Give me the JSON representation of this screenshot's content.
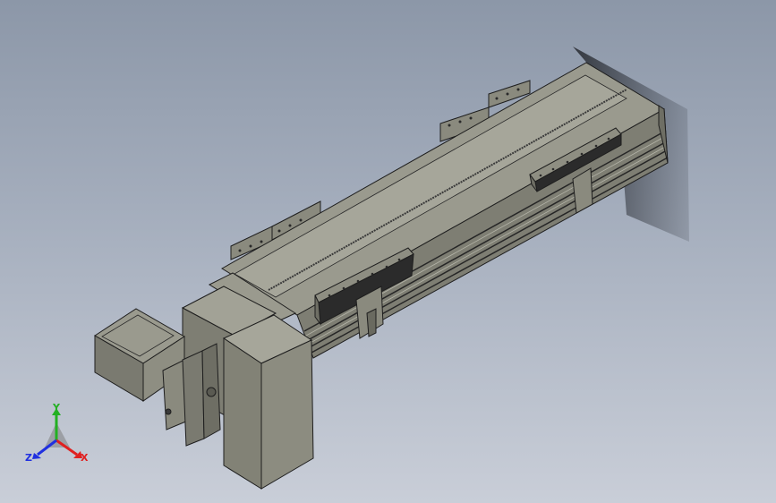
{
  "viewport": {
    "background_top": "#8c97a8",
    "background_bottom": "#c9ced8",
    "model_color": "#8c8c80",
    "model_shadow": "#5e5e55",
    "rail_dark": "#2b2b2b"
  },
  "triad": {
    "x_label": "X",
    "y_label": "Y",
    "z_label": "Z",
    "x_color": "#e02020",
    "y_color": "#22b022",
    "z_color": "#2030e0"
  }
}
